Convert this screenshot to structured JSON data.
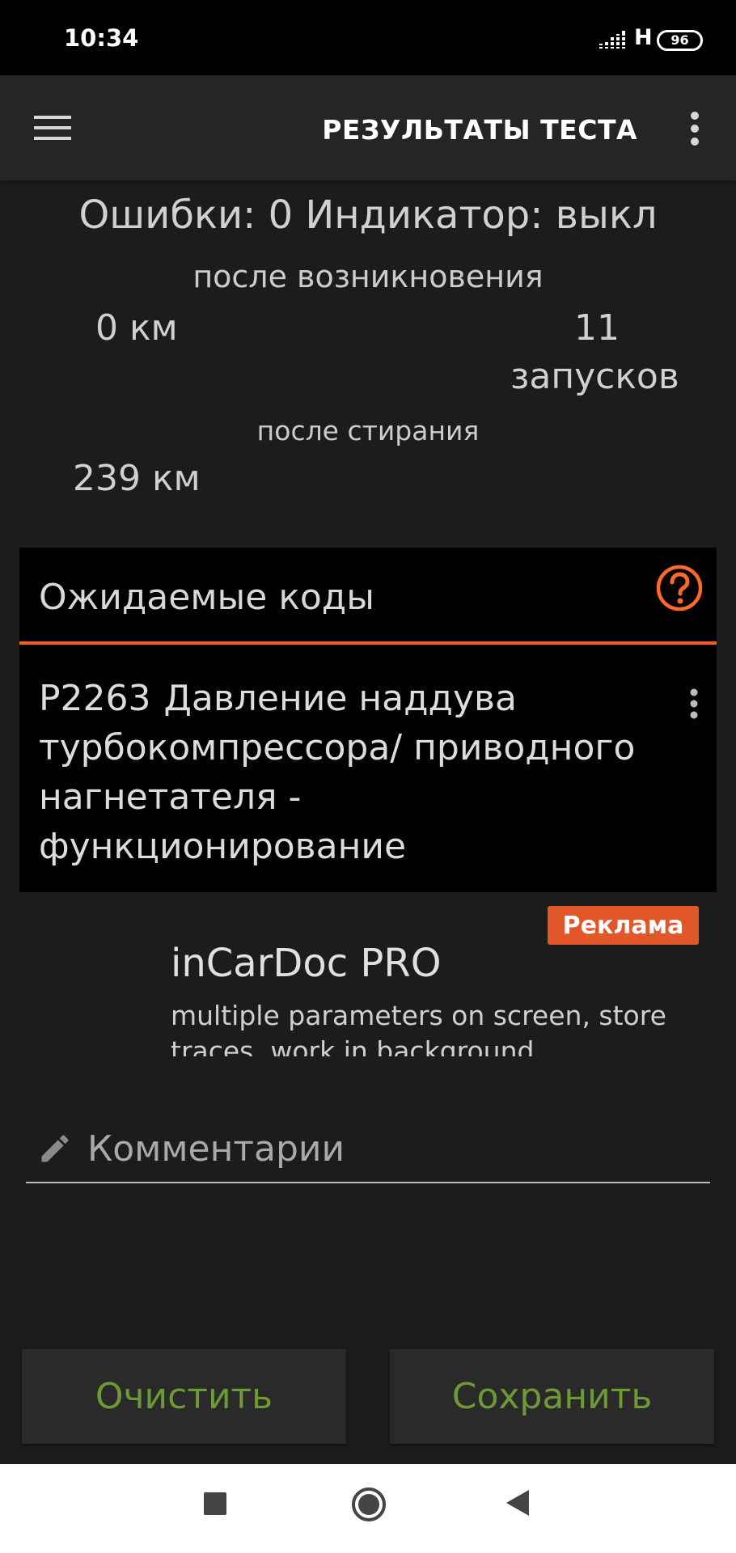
{
  "status_bar": {
    "time": "10:34",
    "network": "H",
    "battery": "96"
  },
  "app_bar": {
    "title": "РЕЗУЛЬТАТЫ ТЕСТА"
  },
  "summary": {
    "errors_line": "Ошибки: 0 Индикатор: выкл",
    "after_occurrence_label": "после возникновения",
    "km_after_occurrence": "0 км",
    "starts_count": "11",
    "starts_label": "запусков",
    "after_clear_label": "после стирания",
    "km_after_clear": "239 км"
  },
  "pending_codes": {
    "title": "Ожидаемые коды",
    "codes": [
      {
        "code": "P2263",
        "description": "Давление наддува турбокомпрессора/ приводного нагнетателя - функционирование"
      }
    ]
  },
  "ad": {
    "badge": "Реклама",
    "title": "inCarDoc PRO",
    "description": "multiple parameters on screen, store traces, work in background"
  },
  "comments": {
    "placeholder": "Комментарии",
    "value": ""
  },
  "buttons": {
    "clear": "Очистить",
    "save": "Сохранить"
  },
  "colors": {
    "accent": "#ff5a1f",
    "ad_badge": "#e2572a",
    "button_text": "#6e9a33",
    "card_bg": "#000000",
    "page_bg": "#1c1c1c",
    "app_bar_bg": "#252525"
  },
  "icons": {
    "menu": "hamburger-menu-icon",
    "overflow": "more-vert-icon",
    "help": "help-circle-icon",
    "code_menu": "more-vert-icon",
    "comment": "pencil-icon",
    "nav_recent": "square-icon",
    "nav_home": "circle-icon",
    "nav_back": "triangle-back-icon"
  }
}
